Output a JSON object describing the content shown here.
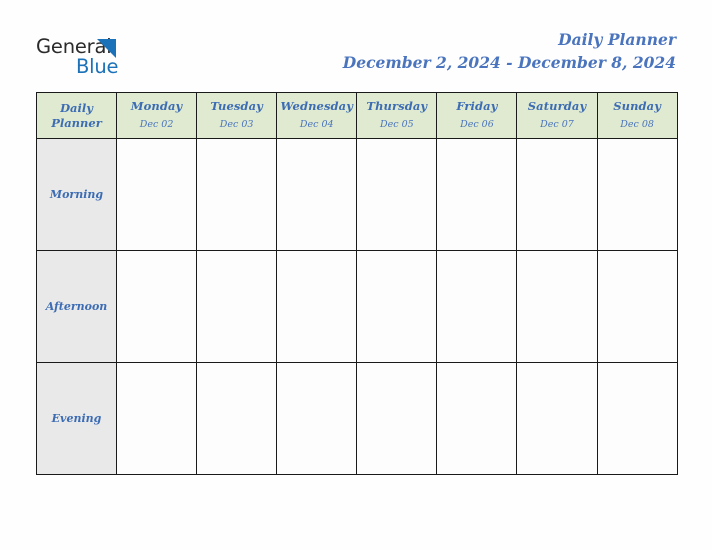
{
  "logo": {
    "word1": "General",
    "word2": "Blue",
    "triangle_color": "#1b72b8",
    "word1_color": "#2b2b2b",
    "word2_color": "#1b72b8"
  },
  "header": {
    "title": "Daily Planner",
    "date_range": "December 2, 2024 - December 8, 2024",
    "title_color": "#4a74bd"
  },
  "table": {
    "corner": {
      "line1": "Daily",
      "line2": "Planner"
    },
    "header_bg": "#dfead0",
    "row_label_bg": "#e9e9e9",
    "accent_text": "#3c6cb4",
    "border_color": "#1a1a1a",
    "columns": [
      {
        "dayname": "Monday",
        "daydate": "Dec 02"
      },
      {
        "dayname": "Tuesday",
        "daydate": "Dec 03"
      },
      {
        "dayname": "Wednesday",
        "daydate": "Dec 04"
      },
      {
        "dayname": "Thursday",
        "daydate": "Dec 05"
      },
      {
        "dayname": "Friday",
        "daydate": "Dec 06"
      },
      {
        "dayname": "Saturday",
        "daydate": "Dec 07"
      },
      {
        "dayname": "Sunday",
        "daydate": "Dec 08"
      }
    ],
    "rows": [
      {
        "label": "Morning",
        "cells": [
          "",
          "",
          "",
          "",
          "",
          "",
          ""
        ]
      },
      {
        "label": "Afternoon",
        "cells": [
          "",
          "",
          "",
          "",
          "",
          "",
          ""
        ]
      },
      {
        "label": "Evening",
        "cells": [
          "",
          "",
          "",
          "",
          "",
          "",
          ""
        ]
      }
    ]
  }
}
